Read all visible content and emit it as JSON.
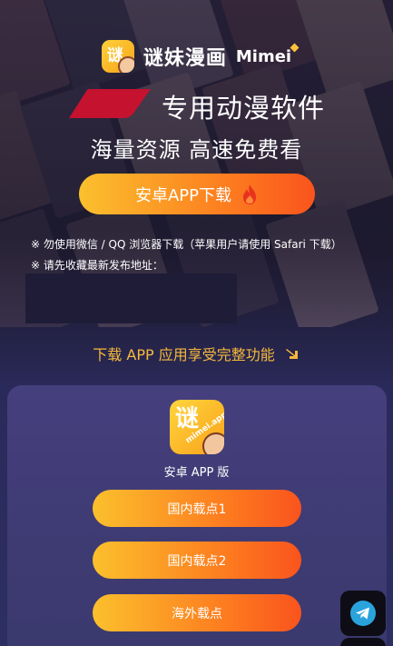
{
  "brand": {
    "name_cn": "谜妹漫画",
    "name_en": "Mimei",
    "logo_glyph": "谜"
  },
  "hero": {
    "tagline_main": "专用动漫软件",
    "tagline_sub": "海量资源 高速免费看"
  },
  "primary_download": {
    "label": "安卓APP下载",
    "icon": "flame-icon"
  },
  "notes": [
    "※ 勿使用微信 / QQ 浏览器下载（苹果用户请使用 Safari 下载）",
    "※ 请先收藏最新发布地址："
  ],
  "download_hint": {
    "text": "下载 APP 应用享受完整功能",
    "icon": "arrow-down-right-icon"
  },
  "app_card": {
    "icon_glyph": "谜",
    "icon_tag": "mimei.app",
    "label": "安卓 APP 版",
    "mirrors": [
      "国内载点1",
      "国内载点2",
      "海外载点"
    ]
  },
  "floating": {
    "icon": "telegram-icon"
  },
  "colors": {
    "accent_start": "#fbc02d",
    "accent_end": "#f9541d",
    "hint": "#f6b93b",
    "ribbon": "#c4122f",
    "card": "#463f7e"
  }
}
